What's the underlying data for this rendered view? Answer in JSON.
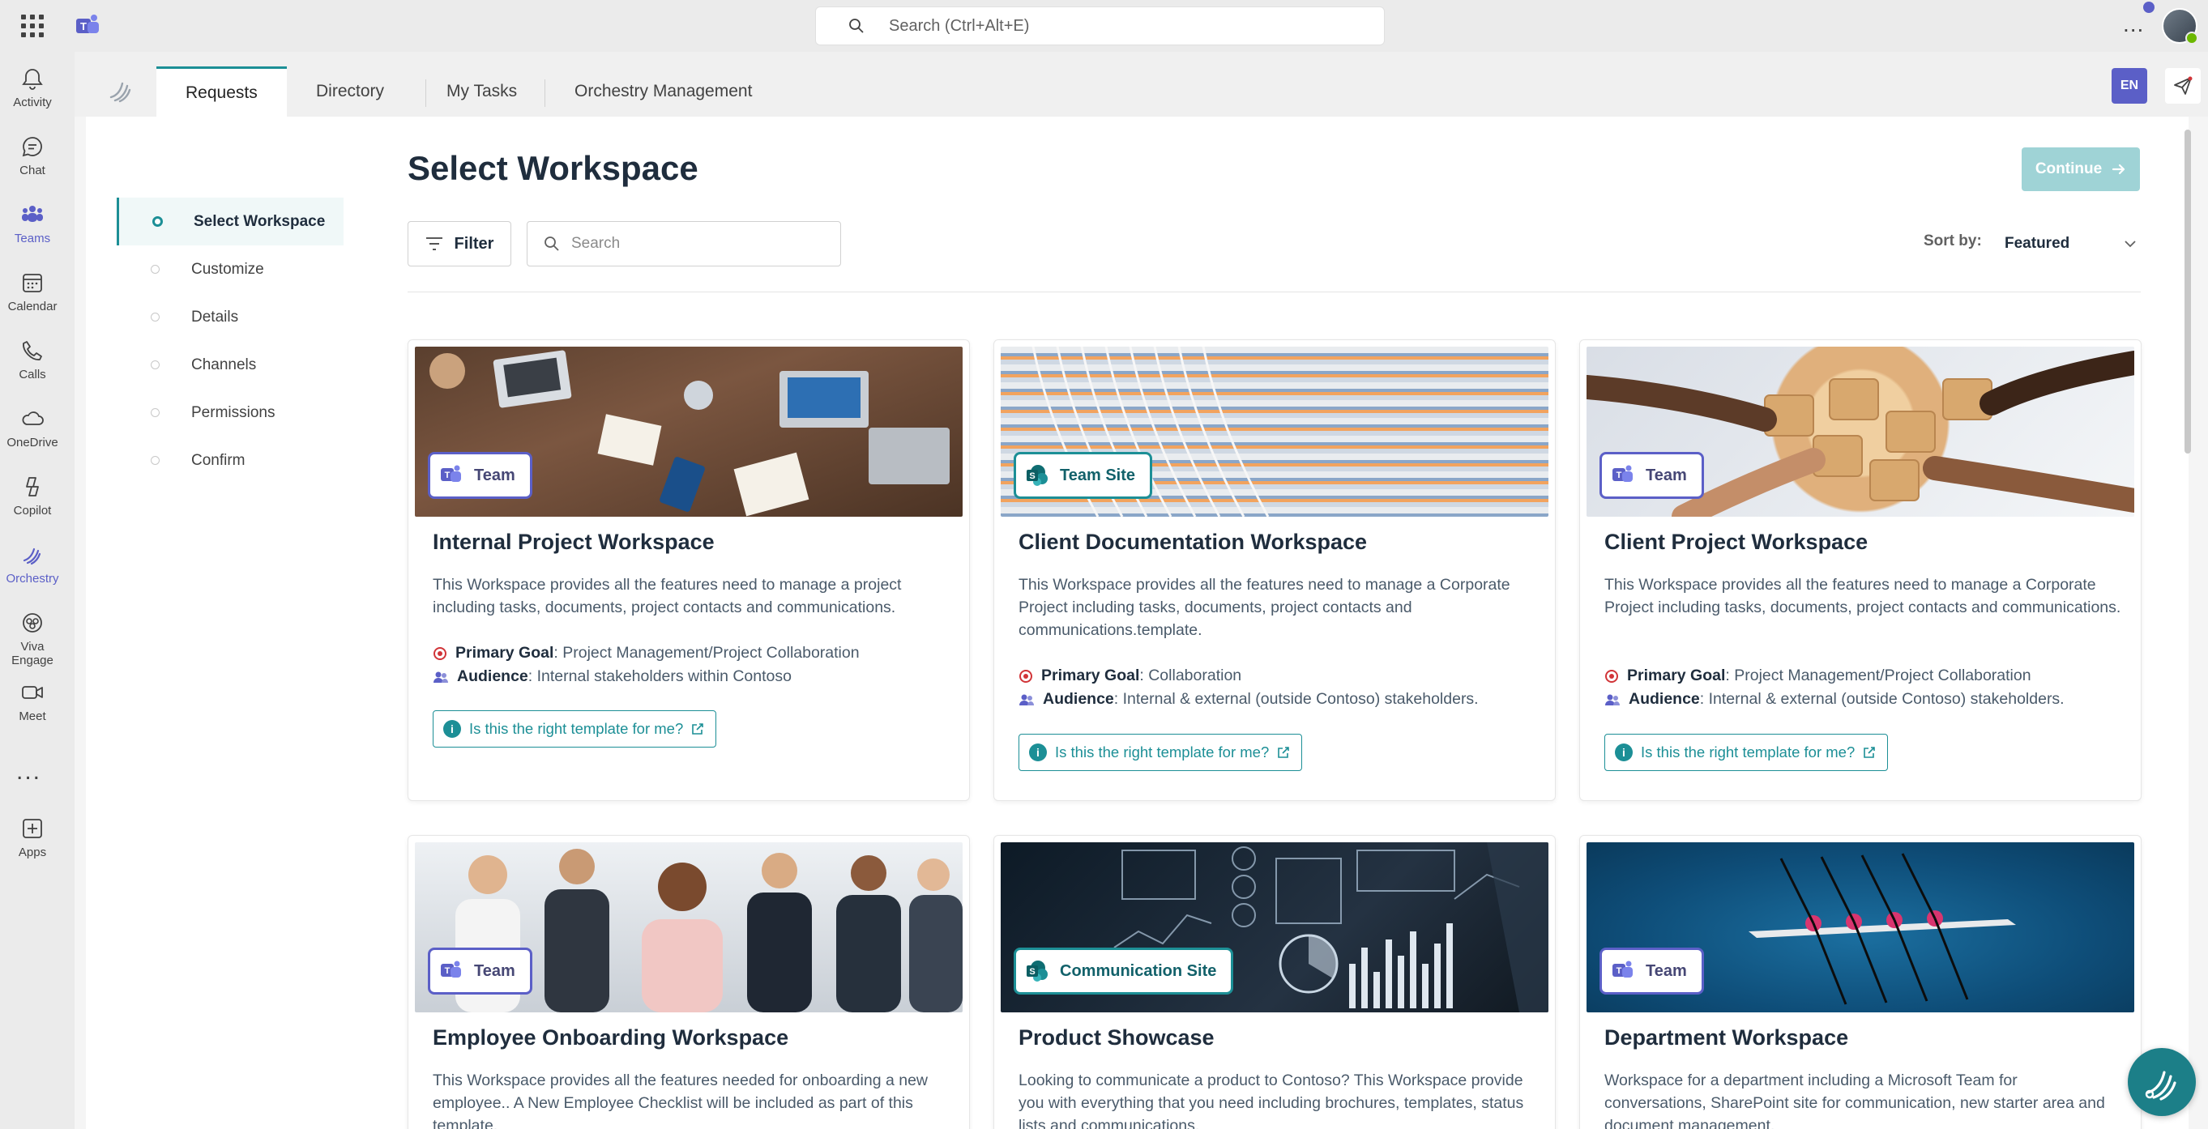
{
  "topbar": {
    "search_placeholder": "Search (Ctrl+Alt+E)",
    "more_label": "..."
  },
  "rail": {
    "items": [
      {
        "label": "Activity"
      },
      {
        "label": "Chat"
      },
      {
        "label": "Teams"
      },
      {
        "label": "Calendar"
      },
      {
        "label": "Calls"
      },
      {
        "label": "OneDrive"
      },
      {
        "label": "Copilot"
      },
      {
        "label": "Orchestry"
      },
      {
        "label": "Viva Engage"
      },
      {
        "label": "Meet"
      },
      {
        "label": "Apps"
      }
    ],
    "more_label": "...",
    "active": "Orchestry"
  },
  "app": {
    "tabs": [
      {
        "label": "Requests"
      },
      {
        "label": "Directory"
      },
      {
        "label": "My Tasks"
      },
      {
        "label": "Orchestry Management"
      }
    ],
    "lang_label": "EN"
  },
  "steps": [
    {
      "label": "Select Workspace"
    },
    {
      "label": "Customize"
    },
    {
      "label": "Details"
    },
    {
      "label": "Channels"
    },
    {
      "label": "Permissions"
    },
    {
      "label": "Confirm"
    }
  ],
  "main": {
    "title": "Select Workspace",
    "continue_label": "Continue",
    "filter_label": "Filter",
    "search_placeholder": "Search",
    "sort_label": "Sort by:",
    "sort_value": "Featured"
  },
  "cards": [
    {
      "badge": "Team",
      "title": "Internal Project Workspace",
      "desc": "This Workspace provides all the features need to manage a project including tasks, documents, project contacts and communications.",
      "goal_label": "Primary Goal",
      "goal": ": Project Management/Project Collaboration",
      "audience_label": "Audience",
      "audience": ": Internal stakeholders within Contoso",
      "link": "Is this the right template for me?"
    },
    {
      "badge": "Team Site",
      "title": "Client Documentation Workspace",
      "desc": "This Workspace provides all the features need to manage a Corporate Project including tasks, documents, project contacts and communications.template.",
      "goal_label": "Primary Goal",
      "goal": ": Collaboration",
      "audience_label": "Audience",
      "audience": ": Internal & external (outside Contoso) stakeholders.",
      "link": "Is this the right template for me?"
    },
    {
      "badge": "Team",
      "title": "Client Project Workspace",
      "desc": "This Workspace provides all the features need to manage a Corporate Project including tasks, documents, project contacts and communications.",
      "goal_label": "Primary Goal",
      "goal": ": Project Management/Project Collaboration",
      "audience_label": "Audience",
      "audience": ": Internal & external (outside Contoso) stakeholders.",
      "link": "Is this the right template for me?"
    },
    {
      "badge": "Team",
      "title": "Employee Onboarding Workspace",
      "desc": "This Workspace provides all the features needed for onboarding a new employee.. A New Employee Checklist will be included as part of this template."
    },
    {
      "badge": "Communication Site",
      "title": "Product Showcase",
      "desc": "Looking to communicate a product to Contoso? This Workspace provide you with everything that you need including brochures, templates, status lists and communications."
    },
    {
      "badge": "Team",
      "title": "Department Workspace",
      "desc": "Workspace for a department including a Microsoft Team for conversations, SharePoint site for communication, new starter area and document management."
    }
  ],
  "colors": {
    "teal": "#1c8f96",
    "teams_purple": "#5b5fc7"
  }
}
